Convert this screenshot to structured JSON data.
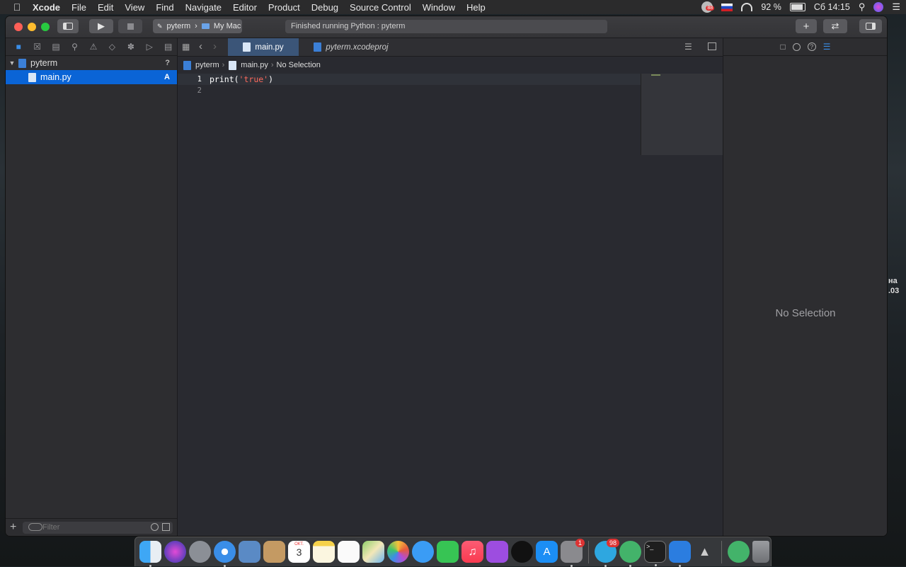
{
  "menubar": {
    "app_name": "Xcode",
    "items": [
      "File",
      "Edit",
      "View",
      "Find",
      "Navigate",
      "Editor",
      "Product",
      "Debug",
      "Source Control",
      "Window",
      "Help"
    ],
    "status": {
      "notification_badge": "88",
      "battery_text": "92 %",
      "battery_level": 0.92,
      "clock": "Сб 14:15"
    }
  },
  "toolbar": {
    "scheme_target": "pyterm",
    "scheme_device": "My Mac",
    "activity_text": "Finished running Python : pyterm",
    "add_label": "+"
  },
  "navigator": {
    "tree": [
      {
        "label": "pyterm",
        "badge": "?"
      },
      {
        "label": "main.py",
        "badge": "A"
      }
    ],
    "filter_placeholder": "Filter"
  },
  "editor": {
    "tabs": [
      {
        "label": "main.py"
      },
      {
        "label": "pyterm.xcodeproj"
      }
    ],
    "jumpbar": [
      "pyterm",
      "main.py",
      "No Selection"
    ],
    "lines": [
      {
        "number": "1",
        "prefix": "print(",
        "string": "'true'",
        "suffix": ")"
      },
      {
        "number": "2",
        "prefix": "",
        "string": "",
        "suffix": ""
      }
    ]
  },
  "inspector": {
    "empty_text": "No Selection"
  },
  "desktop": {
    "peek_line1": "на",
    "peek_line2": ".03"
  },
  "dock": {
    "calendar_month": "ОКТ.",
    "calendar_day": "3",
    "telegram_badge": "98",
    "prefs_badge": "1"
  },
  "colors": {
    "accent": "#0a64d6",
    "string_literal": "#fc6a5d",
    "window_bg": "#292a30"
  }
}
